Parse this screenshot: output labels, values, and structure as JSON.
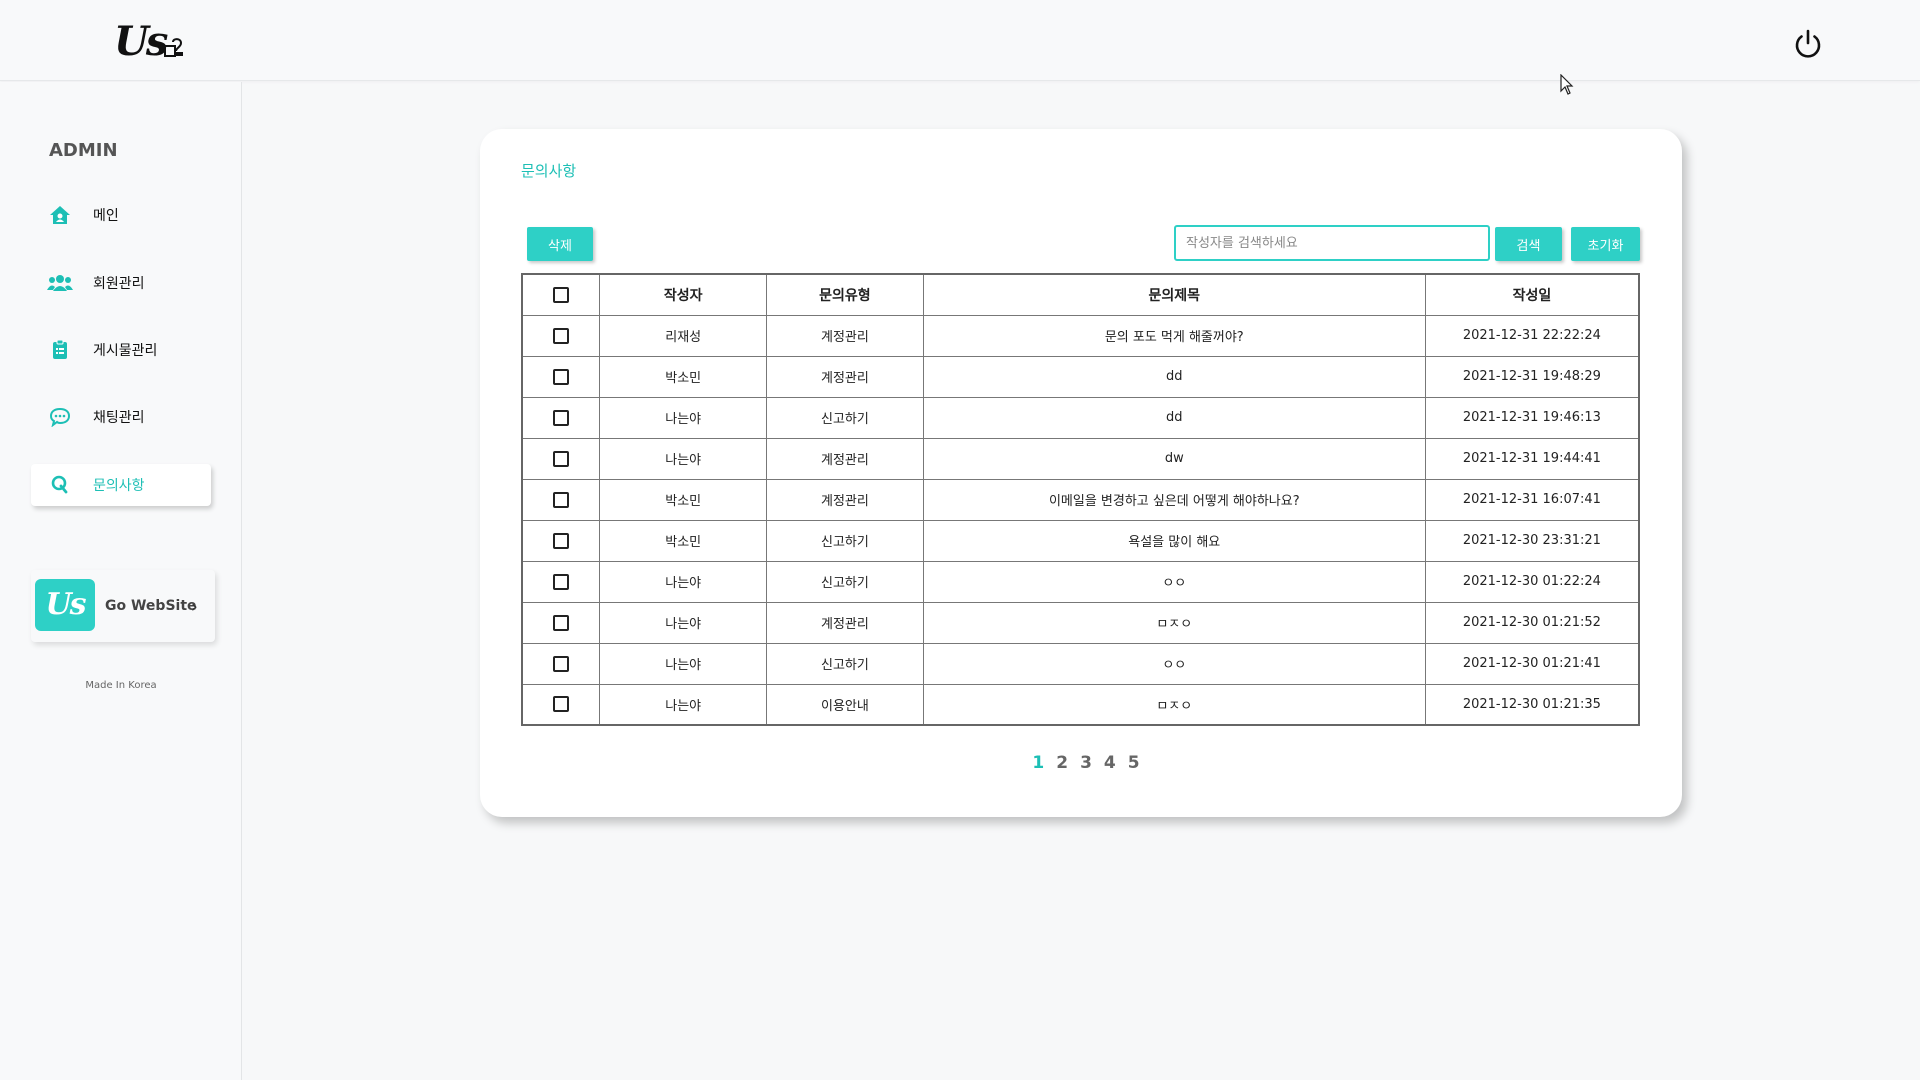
{
  "header": {
    "logo_text": "Us",
    "power_icon": "power-icon"
  },
  "sidebar": {
    "title": "ADMIN",
    "items": [
      {
        "label": "메인",
        "icon": "home-icon",
        "active": false
      },
      {
        "label": "회원관리",
        "icon": "users-icon",
        "active": false
      },
      {
        "label": "게시물관리",
        "icon": "clipboard-icon",
        "active": false
      },
      {
        "label": "채팅관리",
        "icon": "chat-icon",
        "active": false
      },
      {
        "label": "문의사항",
        "icon": "q-icon",
        "active": true
      }
    ],
    "go_website": {
      "logo_text": "Us",
      "label": "Go WebSite",
      "arrow": "›"
    },
    "footer": "Made In Korea"
  },
  "main": {
    "title": "문의사항",
    "delete_label": "삭제",
    "search_placeholder": "작성자를 검색하세요",
    "search_value": "",
    "search_label": "검색",
    "reset_label": "초기화",
    "accent_color": "#2ed0c6",
    "table": {
      "headers": [
        "작성자",
        "문의유형",
        "문의제목",
        "작성일"
      ],
      "rows": [
        {
          "author": "리재성",
          "type": "계정관리",
          "title": "문의 포도 먹게 해줄꺼야?",
          "date": "2021-12-31 22:22:24"
        },
        {
          "author": "박소민",
          "type": "계정관리",
          "title": "dd",
          "date": "2021-12-31 19:48:29"
        },
        {
          "author": "나는야",
          "type": "신고하기",
          "title": "dd",
          "date": "2021-12-31 19:46:13"
        },
        {
          "author": "나는야",
          "type": "계정관리",
          "title": "dw",
          "date": "2021-12-31 19:44:41"
        },
        {
          "author": "박소민",
          "type": "계정관리",
          "title": "이메일을 변경하고 싶은데 어떻게 해야하나요?",
          "date": "2021-12-31 16:07:41"
        },
        {
          "author": "박소민",
          "type": "신고하기",
          "title": "욕설을 많이 해요",
          "date": "2021-12-30 23:31:21"
        },
        {
          "author": "나는야",
          "type": "신고하기",
          "title": "ㅇㅇ",
          "date": "2021-12-30 01:22:24"
        },
        {
          "author": "나는야",
          "type": "계정관리",
          "title": "ㅁㅈㅇ",
          "date": "2021-12-30 01:21:52"
        },
        {
          "author": "나는야",
          "type": "신고하기",
          "title": "ㅇㅇ",
          "date": "2021-12-30 01:21:41"
        },
        {
          "author": "나는야",
          "type": "이용안내",
          "title": "ㅁㅈㅇ",
          "date": "2021-12-30 01:21:35"
        }
      ]
    },
    "pagination": {
      "pages": [
        "1",
        "2",
        "3",
        "4",
        "5"
      ],
      "current": "1"
    }
  }
}
